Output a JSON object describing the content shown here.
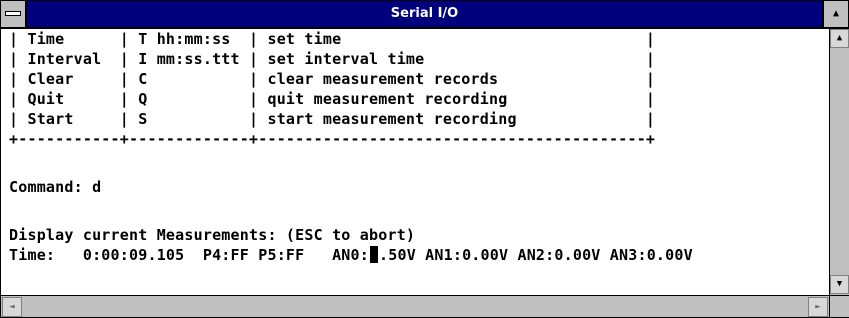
{
  "window": {
    "title": "Serial I/O"
  },
  "icons": {
    "system_menu": "system-menu-icon",
    "scroll_up": "arrow-up-icon",
    "scroll_down": "arrow-down-icon",
    "scroll_left": "arrow-left-icon",
    "scroll_right": "arrow-right-icon"
  },
  "glyphs": {
    "title_right": "▲",
    "scroll_up": "▲",
    "scroll_down": "▼",
    "scroll_left": "◄",
    "scroll_right": "►"
  },
  "colors": {
    "titlebar": "#00007f",
    "console_bg": "#ffffff",
    "text": "#000000",
    "chrome": "#c0c0c0"
  },
  "console": {
    "command_rows": [
      "| Time      | T hh:mm:ss  | set time                                 |",
      "| Interval  | I mm:ss.ttt | set interval time                        |",
      "| Clear     | C           | clear measurement records                |",
      "| Quit      | Q           | quit measurement recording               |",
      "| Start     | S           | start measurement recording              |"
    ],
    "separator": "+-----------+-------------+------------------------------------------+",
    "command_prompt": "Command: d",
    "display_message": "Display current Measurements: (ESC to abort)",
    "status_line_before_cursor": "Time:   0:00:09.105  P4:FF P5:FF   AN0:",
    "status_line_after_cursor": ".50V AN1:0.00V AN2:0.00V AN3:0.00V"
  }
}
